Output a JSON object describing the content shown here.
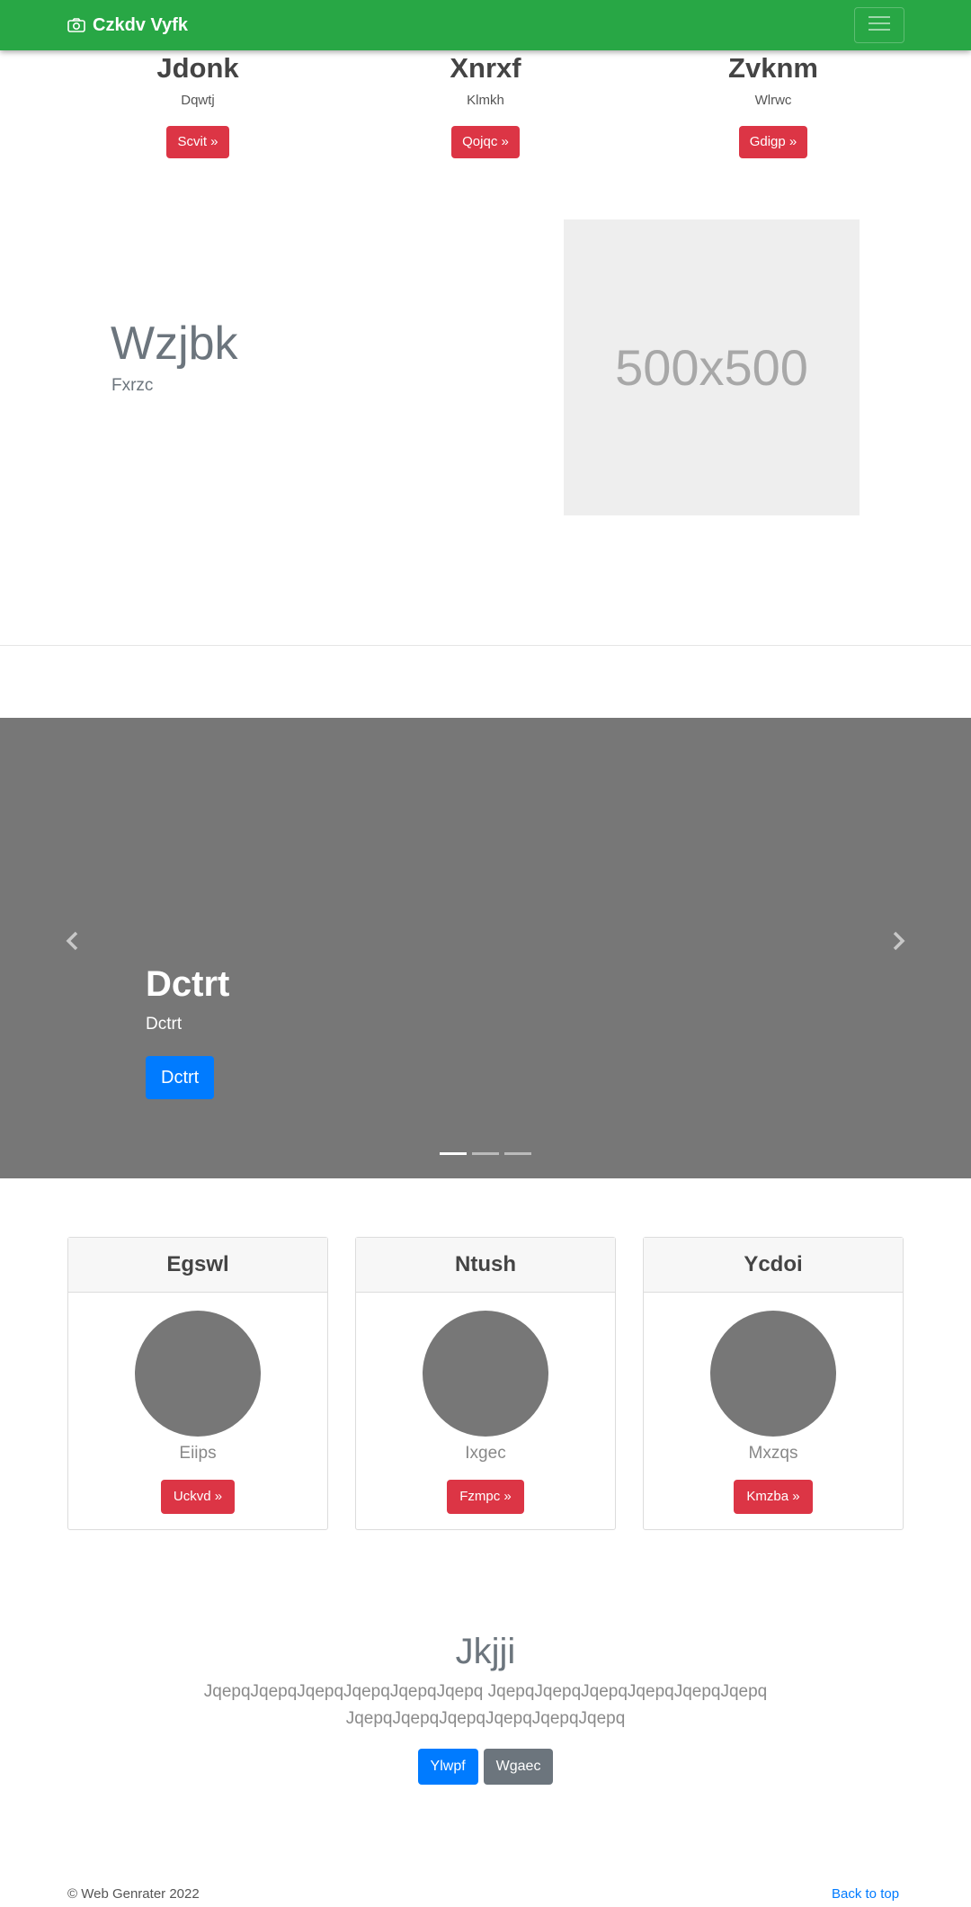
{
  "navbar": {
    "brand": "Czkdv Vyfk",
    "brand_icon": "camera-icon",
    "toggler_icon": "hamburger-icon",
    "bg_color": "#28a745"
  },
  "top_columns": [
    {
      "title": "Jdonk",
      "subtitle": "Dqwtj",
      "button": "Scvit »"
    },
    {
      "title": "Xnrxf",
      "subtitle": "Klmkh",
      "button": "Qojqc »"
    },
    {
      "title": "Zvknm",
      "subtitle": "Wlrwc",
      "button": "Gdigp »"
    }
  ],
  "feature": {
    "title": "Wzjbk",
    "subtitle": "Fxrzc",
    "image_label": "500x500"
  },
  "carousel": {
    "title": "Dctrt",
    "subtitle": "Dctrt",
    "button": "Dctrt",
    "slide_count": 3,
    "active_index": 0,
    "prev_icon": "chevron-left-icon",
    "next_icon": "chevron-right-icon"
  },
  "cards": [
    {
      "header": "Egswl",
      "name": "Eiips",
      "button": "Uckvd »"
    },
    {
      "header": "Ntush",
      "name": "Ixgec",
      "button": "Fzmpc »"
    },
    {
      "header": "Ycdoi",
      "name": "Mxzqs",
      "button": "Kmzba »"
    }
  ],
  "cta": {
    "title": "Jkjji",
    "text": "JqepqJqepqJqepqJqepqJqepqJqepq JqepqJqepqJqepqJqepqJqepqJqepq JqepqJqepqJqepqJqepqJqepqJqepq",
    "primary_button": "Ylwpf",
    "secondary_button": "Wgaec"
  },
  "footer": {
    "copyright": "© Web Genrater 2022",
    "back_to_top": "Back to top"
  },
  "colors": {
    "accent_red": "#dc3545",
    "accent_blue": "#007bff",
    "secondary_gray": "#6c757d"
  }
}
